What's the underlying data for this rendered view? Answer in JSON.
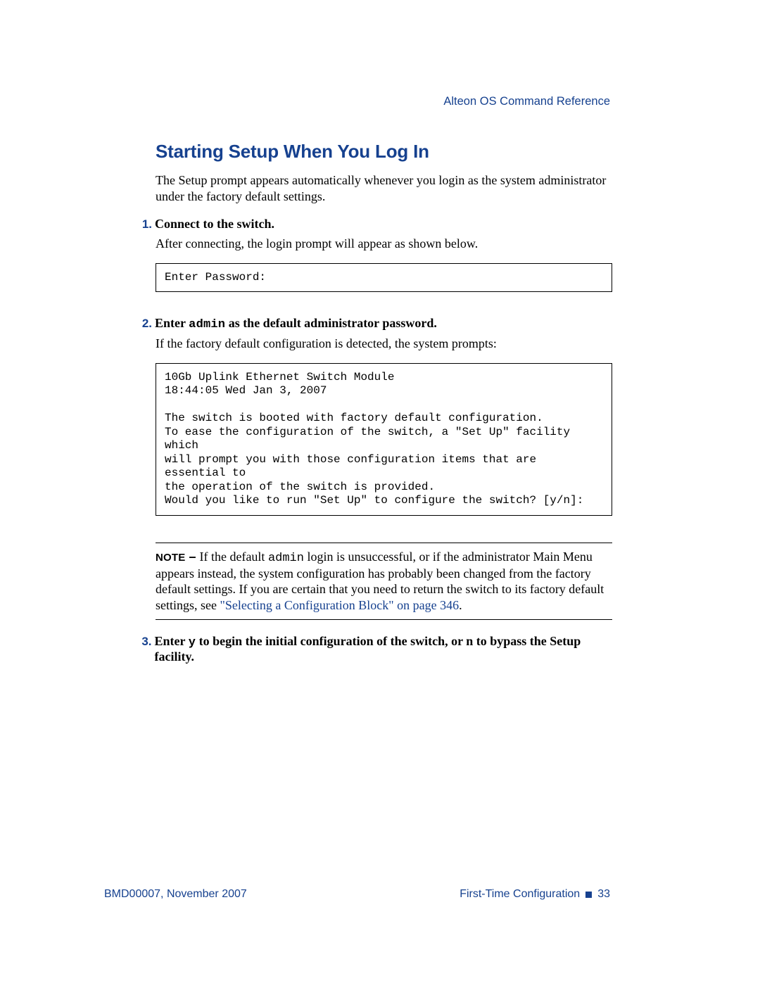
{
  "header": {
    "running_title": "Alteon OS  Command Reference"
  },
  "section": {
    "title": "Starting Setup When You Log In",
    "intro": "The Setup prompt appears automatically whenever you login as the system administrator under the factory default settings."
  },
  "steps": [
    {
      "num": "1.",
      "label": "Connect to the switch.",
      "body": "After connecting, the login prompt will appear as shown below.",
      "code": "Enter Password:"
    },
    {
      "num": "2.",
      "label_prefix": "Enter ",
      "label_mono": "admin",
      "label_suffix": " as the default administrator password.",
      "body": "If the factory default configuration is detected, the system prompts:",
      "code": "10Gb Uplink Ethernet Switch Module\n18:44:05 Wed Jan 3, 2007\n\nThe switch is booted with factory default configuration.\nTo ease the configuration of the switch, a \"Set Up\" facility which\nwill prompt you with those configuration items that are essential to\nthe operation of the switch is provided.\nWould you like to run \"Set Up\" to configure the switch? [y/n]:"
    },
    {
      "num": "3.",
      "label_prefix": "Enter ",
      "label_mono": "y",
      "label_suffix": " to begin the initial configuration of the switch, or n to bypass the Setup facility."
    }
  ],
  "note": {
    "label": "NOTE",
    "dash": " – ",
    "text_1": "If the default ",
    "mono": "admin",
    "text_2": " login is unsuccessful, or if the administrator Main Menu appears instead, the system configuration has probably been changed from the factory default settings. If you are certain that you need to return the switch to its factory default settings, see ",
    "link": "\"Selecting a Configuration Block\" on page 346",
    "text_3": "."
  },
  "footer": {
    "left": "BMD00007, November 2007",
    "right_label": "First-Time Configuration",
    "page_num": "33"
  }
}
